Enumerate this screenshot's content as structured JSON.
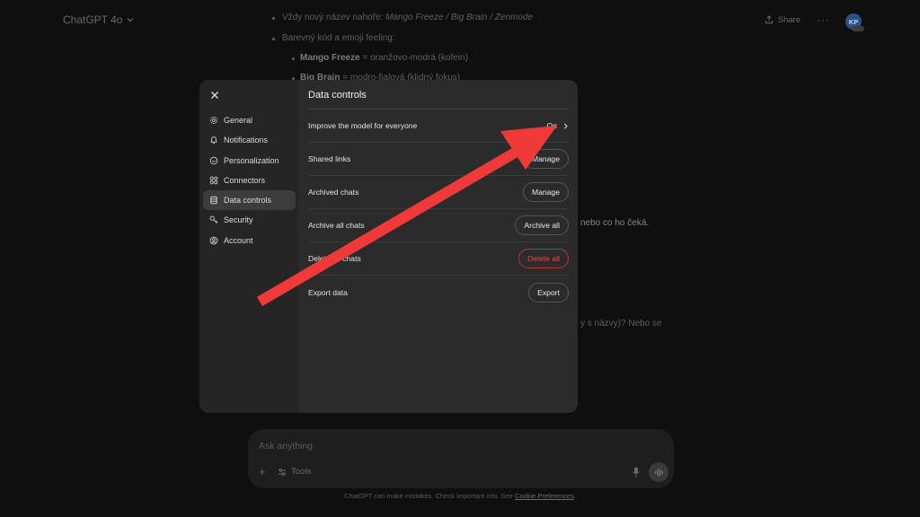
{
  "header": {
    "model_label": "ChatGPT 4o",
    "share_label": "Share",
    "more_label": "···",
    "avatar_initials": "KP"
  },
  "chat": {
    "line1_prefix": "Vždy nový název nahoře: ",
    "line1_names": "Mango Freeze / Big Brain / Zenmode",
    "line2": "Barevný kód a emoji feeling:",
    "line3_bold": "Mango Freeze",
    "line3_rest": " = oranžovo-modrá (kofein)",
    "line4_bold": "Big Brain",
    "line4_rest": " = modro-fialová (klidný fokus)",
    "partial1": "nebo co ho čeká.",
    "partial2": "y s názvy)? Nebo se"
  },
  "composer": {
    "placeholder": "Ask anything",
    "plus_label": "+",
    "tools_label": "Tools"
  },
  "footer": {
    "note": "ChatGPT can make mistakes. Check important info. See ",
    "link": "Cookie Preferences",
    "end": "."
  },
  "settings": {
    "title": "Data controls",
    "nav": [
      {
        "label": "General",
        "icon": "gear-icon"
      },
      {
        "label": "Notifications",
        "icon": "bell-icon"
      },
      {
        "label": "Personalization",
        "icon": "personalization-icon"
      },
      {
        "label": "Connectors",
        "icon": "connectors-icon"
      },
      {
        "label": "Data controls",
        "icon": "database-icon",
        "active": true
      },
      {
        "label": "Security",
        "icon": "key-icon"
      },
      {
        "label": "Account",
        "icon": "user-circle-icon"
      }
    ],
    "rows": [
      {
        "label": "Improve the model for everyone",
        "value": "On"
      },
      {
        "label": "Shared links",
        "button": "Manage"
      },
      {
        "label": "Archived chats",
        "button": "Manage"
      },
      {
        "label": "Archive all chats",
        "button": "Archive all"
      },
      {
        "label": "Delete all chats",
        "button": "Delete all"
      },
      {
        "label": "Export data",
        "button": "Export"
      }
    ]
  },
  "colors": {
    "annotation_arrow": "#f03a3a",
    "danger": "#e24a4a",
    "avatar": "#2c4f86"
  }
}
